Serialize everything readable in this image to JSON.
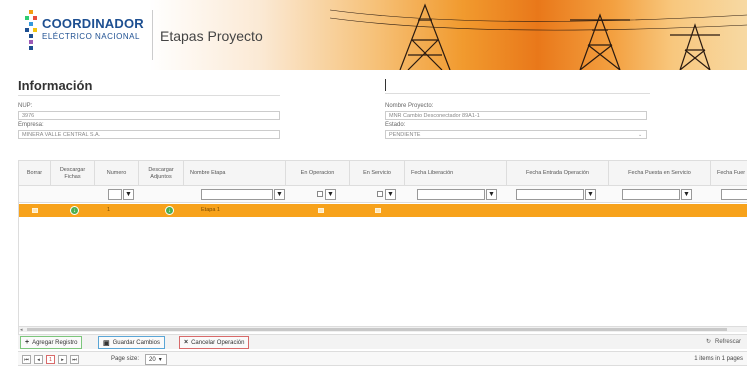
{
  "header": {
    "logo_line1": "COORDINADOR",
    "logo_line2": "ELÉCTRICO NACIONAL",
    "page_title": "Etapas Proyecto"
  },
  "info": {
    "title": "Información",
    "nup_label": "NUP:",
    "nup_value": "3976",
    "empresa_label": "Empresa:",
    "empresa_value": "MINERA VALLE CENTRAL S.A.",
    "nombre_label": "Nombre Proyecto:",
    "nombre_value": "MNR Cambio Desconectador 89A1-1",
    "estado_label": "Estado:",
    "estado_value": "PENDIENTE"
  },
  "grid": {
    "columns": [
      "Borrar",
      "Descargar Fichas",
      "Numero",
      "Descargar Adjuntos",
      "Nombre Etapa",
      "En Operacion",
      "En Servicio",
      "Fecha Liberación",
      "Fecha Entrada Operación",
      "Fecha Puesta en Servicio",
      "Fecha Fuer"
    ],
    "rows": [
      {
        "numero": "1",
        "nombre": "Etapa 1"
      }
    ],
    "filter_icon": "▼"
  },
  "toolbar": {
    "add": "Agregar Registro",
    "save": "Guardar Cambios",
    "cancel": "Cancelar Operación",
    "refresh": "Refrescar"
  },
  "pager": {
    "current_page": "1",
    "page_size_label": "Page size:",
    "page_size": "20",
    "items_info": "1 items in 1 pages"
  },
  "colors": {
    "row_highlight": "#f7a21b",
    "brand_blue": "#1d4f91"
  }
}
